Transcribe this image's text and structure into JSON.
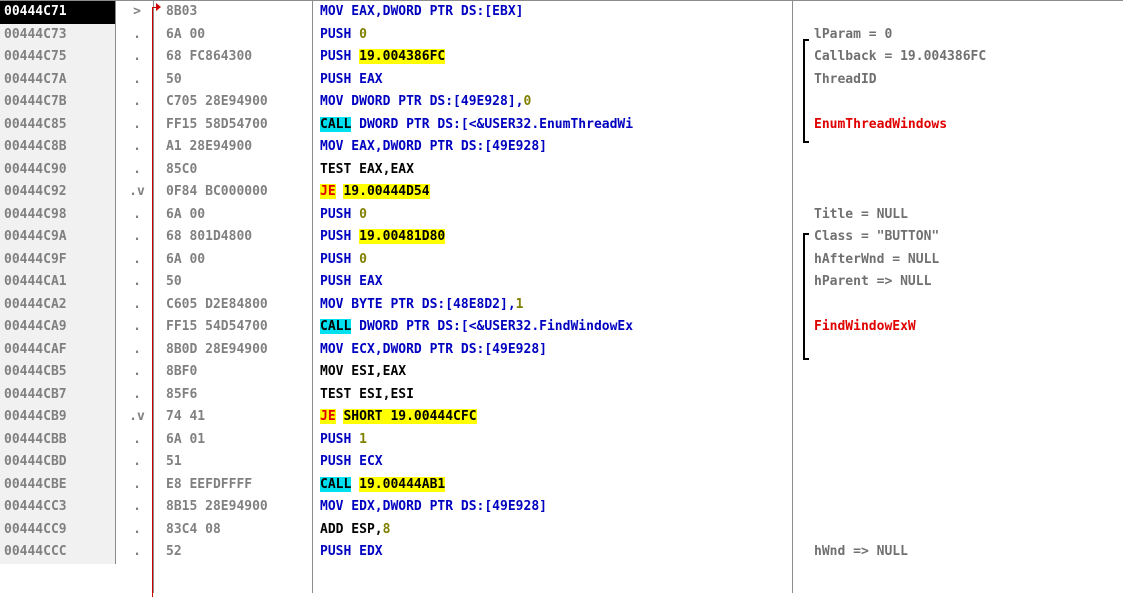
{
  "rows": [
    {
      "addr": "00444C71",
      "mark": ">",
      "hex": "8B03",
      "ins": [
        {
          "t": "MOV EAX,DWORD PTR DS:[EBX]",
          "c": "push"
        }
      ],
      "cmt": "",
      "selected": true
    },
    {
      "addr": "00444C73",
      "mark": ".",
      "hex": "6A 00",
      "ins": [
        {
          "t": "PUSH ",
          "c": "push"
        },
        {
          "t": "0",
          "c": "num"
        }
      ],
      "cmt": "lParam = 0"
    },
    {
      "addr": "00444C75",
      "mark": ".",
      "hex": "68 FC864300",
      "ins": [
        {
          "t": "PUSH ",
          "c": "push"
        },
        {
          "t": "19.004386FC",
          "c": "hl-y"
        }
      ],
      "cmt": "Callback = 19.004386FC"
    },
    {
      "addr": "00444C7A",
      "mark": ".",
      "hex": "50",
      "ins": [
        {
          "t": "PUSH EAX",
          "c": "push"
        }
      ],
      "cmt": "ThreadID"
    },
    {
      "addr": "00444C7B",
      "mark": ".",
      "hex": "C705 28E94900",
      "ins": [
        {
          "t": "MOV DWORD PTR DS:[49E928],",
          "c": "push"
        },
        {
          "t": "0",
          "c": "num"
        }
      ],
      "cmt": ""
    },
    {
      "addr": "00444C85",
      "mark": ".",
      "hex": "FF15 58D54700",
      "ins": [
        {
          "t": "CALL",
          "c": "hl-c"
        },
        {
          "t": " DWORD PTR DS:[<&USER32.EnumThreadWi",
          "c": "push"
        }
      ],
      "cmt": "EnumThreadWindows",
      "cmtc": "cmt-red"
    },
    {
      "addr": "00444C8B",
      "mark": ".",
      "hex": "A1 28E94900",
      "ins": [
        {
          "t": "MOV EAX,DWORD PTR DS:[49E928]",
          "c": "push"
        }
      ],
      "cmt": ""
    },
    {
      "addr": "00444C90",
      "mark": ".",
      "hex": "85C0",
      "ins": [
        {
          "t": "TEST EAX,EAX",
          "c": ""
        }
      ],
      "cmt": ""
    },
    {
      "addr": "00444C92",
      "mark": ".v",
      "hex": "0F84 BC000000",
      "ins": [
        {
          "t": "JE",
          "c": "jmp hl-y"
        },
        {
          "t": " ",
          "c": ""
        },
        {
          "t": "19.00444D54",
          "c": "hl-y"
        }
      ],
      "cmt": ""
    },
    {
      "addr": "00444C98",
      "mark": ".",
      "hex": "6A 00",
      "ins": [
        {
          "t": "PUSH ",
          "c": "push"
        },
        {
          "t": "0",
          "c": "num"
        }
      ],
      "cmt": "Title = NULL"
    },
    {
      "addr": "00444C9A",
      "mark": ".",
      "hex": "68 801D4800",
      "ins": [
        {
          "t": "PUSH ",
          "c": "push"
        },
        {
          "t": "19.00481D80",
          "c": "hl-y"
        }
      ],
      "cmt": "Class = \"BUTTON\""
    },
    {
      "addr": "00444C9F",
      "mark": ".",
      "hex": "6A 00",
      "ins": [
        {
          "t": "PUSH ",
          "c": "push"
        },
        {
          "t": "0",
          "c": "num"
        }
      ],
      "cmt": "hAfterWnd = NULL"
    },
    {
      "addr": "00444CA1",
      "mark": ".",
      "hex": "50",
      "ins": [
        {
          "t": "PUSH EAX",
          "c": "push"
        }
      ],
      "cmt": "hParent => NULL"
    },
    {
      "addr": "00444CA2",
      "mark": ".",
      "hex": "C605 D2E84800",
      "ins": [
        {
          "t": "MOV BYTE PTR DS:[48E8D2],",
          "c": "push"
        },
        {
          "t": "1",
          "c": "num"
        }
      ],
      "cmt": ""
    },
    {
      "addr": "00444CA9",
      "mark": ".",
      "hex": "FF15 54D54700",
      "ins": [
        {
          "t": "CALL",
          "c": "hl-c"
        },
        {
          "t": " DWORD PTR DS:[<&USER32.FindWindowEx",
          "c": "push"
        }
      ],
      "cmt": "FindWindowExW",
      "cmtc": "cmt-red"
    },
    {
      "addr": "00444CAF",
      "mark": ".",
      "hex": "8B0D 28E94900",
      "ins": [
        {
          "t": "MOV ECX,DWORD PTR DS:[49E928]",
          "c": "push"
        }
      ],
      "cmt": ""
    },
    {
      "addr": "00444CB5",
      "mark": ".",
      "hex": "8BF0",
      "ins": [
        {
          "t": "MOV ESI,EAX",
          "c": ""
        }
      ],
      "cmt": ""
    },
    {
      "addr": "00444CB7",
      "mark": ".",
      "hex": "85F6",
      "ins": [
        {
          "t": "TEST ESI,ESI",
          "c": ""
        }
      ],
      "cmt": ""
    },
    {
      "addr": "00444CB9",
      "mark": ".v",
      "hex": "74 41",
      "ins": [
        {
          "t": "JE",
          "c": "jmp hl-y"
        },
        {
          "t": " ",
          "c": ""
        },
        {
          "t": "SHORT 19.00444CFC",
          "c": "hl-y"
        }
      ],
      "cmt": ""
    },
    {
      "addr": "00444CBB",
      "mark": ".",
      "hex": "6A 01",
      "ins": [
        {
          "t": "PUSH ",
          "c": "push"
        },
        {
          "t": "1",
          "c": "num"
        }
      ],
      "cmt": ""
    },
    {
      "addr": "00444CBD",
      "mark": ".",
      "hex": "51",
      "ins": [
        {
          "t": "PUSH ECX",
          "c": "push"
        }
      ],
      "cmt": ""
    },
    {
      "addr": "00444CBE",
      "mark": ".",
      "hex": "E8 EEFDFFFF",
      "ins": [
        {
          "t": "CALL",
          "c": "hl-c"
        },
        {
          "t": " ",
          "c": ""
        },
        {
          "t": "19.00444AB1",
          "c": "hl-y"
        }
      ],
      "cmt": ""
    },
    {
      "addr": "00444CC3",
      "mark": ".",
      "hex": "8B15 28E94900",
      "ins": [
        {
          "t": "MOV EDX,DWORD PTR DS:[49E928]",
          "c": "push"
        }
      ],
      "cmt": ""
    },
    {
      "addr": "00444CC9",
      "mark": ".",
      "hex": "83C4 08",
      "ins": [
        {
          "t": "ADD ESP,",
          "c": ""
        },
        {
          "t": "8",
          "c": "num"
        }
      ],
      "cmt": ""
    },
    {
      "addr": "00444CCC",
      "mark": ".",
      "hex": "52",
      "ins": [
        {
          "t": "PUSH EDX",
          "c": "push"
        }
      ],
      "cmt": "hWnd => NULL"
    }
  ]
}
